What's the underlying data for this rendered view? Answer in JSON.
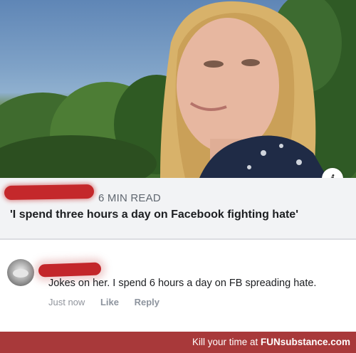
{
  "article": {
    "read_time": "6 MIN READ",
    "headline": "'I spend three hours a day on Facebook fighting hate'"
  },
  "comment": {
    "text": "Jokes on her. I spend 6 hours a day on FB spreading hate.",
    "timestamp": "Just now",
    "like_label": "Like",
    "reply_label": "Reply"
  },
  "watermark": {
    "prefix": "Kill your time at ",
    "brand": "FUNsubstance.com"
  },
  "icons": {
    "info": "info-icon"
  },
  "colors": {
    "watermark_bar": "#a8393a",
    "redaction": "#c4282b"
  }
}
